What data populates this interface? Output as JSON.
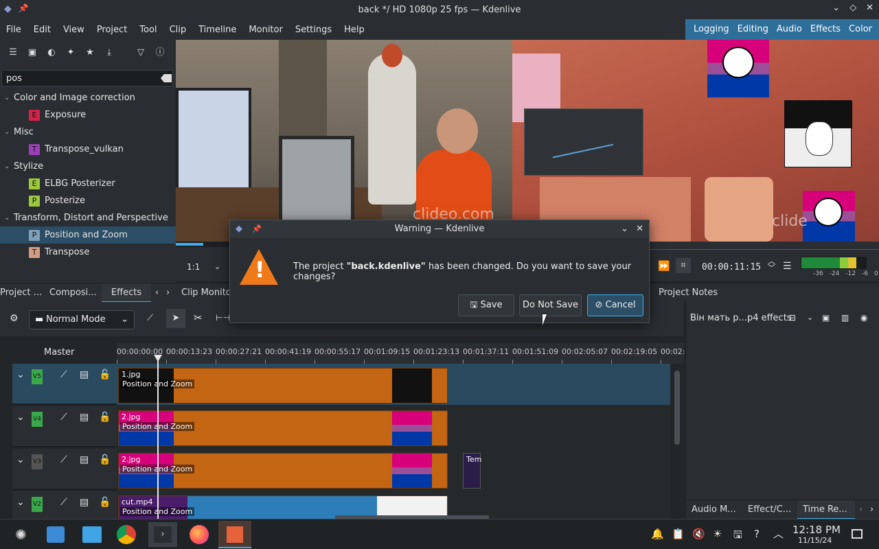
{
  "window": {
    "title": "back */ HD 1080p 25 fps — Kdenlive"
  },
  "menu": [
    "File",
    "Edit",
    "View",
    "Project",
    "Tool",
    "Clip",
    "Timeline",
    "Monitor",
    "Settings",
    "Help"
  ],
  "layouts": [
    "Logging",
    "Editing",
    "Audio",
    "Effects",
    "Color"
  ],
  "effects": {
    "search_value": "pos",
    "tree": [
      {
        "kind": "cat",
        "label": "Color and Image correction"
      },
      {
        "kind": "leaf",
        "badge": "E",
        "color": "#d4234b",
        "label": "Exposure"
      },
      {
        "kind": "cat",
        "label": "Misc"
      },
      {
        "kind": "leaf",
        "badge": "T",
        "color": "#9a3fb8",
        "label": "Transpose_vulkan"
      },
      {
        "kind": "cat",
        "label": "Stylize"
      },
      {
        "kind": "leaf",
        "badge": "E",
        "color": "#9bc83c",
        "label": "ELBG Posterizer"
      },
      {
        "kind": "leaf",
        "badge": "P",
        "color": "#9bc83c",
        "label": "Posterize"
      },
      {
        "kind": "cat",
        "label": "Transform, Distort and Perspective"
      },
      {
        "kind": "leaf",
        "badge": "P",
        "color": "#7f9fb8",
        "label": "Position and Zoom",
        "selected": true
      },
      {
        "kind": "leaf",
        "badge": "T",
        "color": "#d49c84",
        "label": "Transpose"
      }
    ]
  },
  "monitor": {
    "zoom": "1:1",
    "timecode": "00:00:11:15",
    "meter_labels": [
      "-36",
      "-24",
      "-12",
      "-6",
      "0"
    ],
    "clip_watermark": "clideo.com",
    "proj_watermark": "clide"
  },
  "tabs": {
    "project": "Project ...",
    "compositions": "Composi...",
    "effects": "Effects",
    "clip_monitor": "Clip Monitor",
    "project_notes": "Project Notes"
  },
  "timeline": {
    "mode": "Normal Mode",
    "master": "Master",
    "ruler": [
      "00:00:00:00",
      "00:00:13:23",
      "00:00:27:21",
      "00:00:41:19",
      "00:00:55:17",
      "00:01:09:15",
      "00:01:23:13",
      "00:01:37:11",
      "00:01:51:09",
      "00:02:05:07",
      "00:02:19:05",
      "00:02:3"
    ],
    "tracks": [
      {
        "label": "V5",
        "clip": "1.jpg",
        "fx": "Position and Zoom",
        "color": "#3aa84a"
      },
      {
        "label": "V4",
        "clip": "2.jpg",
        "fx": "Position and Zoom",
        "color": "#3aa84a"
      },
      {
        "label": "V3",
        "clip": "2.jpg",
        "fx": "Position and Zoom",
        "color": "#555"
      },
      {
        "label": "V2",
        "clip": "cut.mp4",
        "fx": "Position and Zoom",
        "color": "#3aa84a"
      }
    ],
    "extra_clip": "Tem"
  },
  "right_panel": {
    "title": "Він мать р...p4 effects",
    "tabs": [
      "Audio M...",
      "Effect/C...",
      "Time Re..."
    ]
  },
  "dialog": {
    "title": "Warning — Kdenlive",
    "message_pre": "The project ",
    "message_bold": "\"back.kdenlive\"",
    "message_post": " has been changed. Do you want to save your changes?",
    "save": "Save",
    "dont_save": "Do Not Save",
    "cancel": "Cancel"
  },
  "taskbar": {
    "time": "12:18 PM",
    "date": "11/15/24"
  }
}
